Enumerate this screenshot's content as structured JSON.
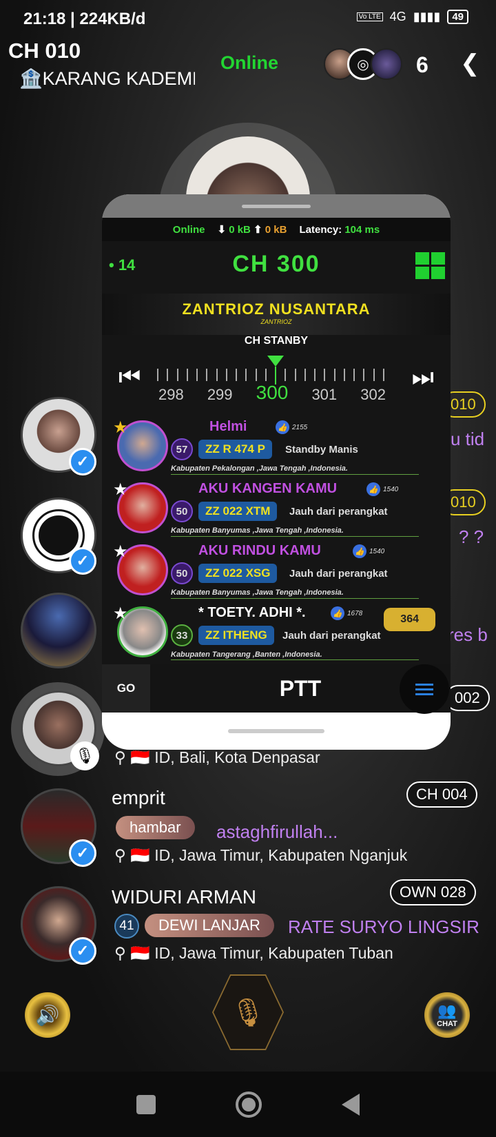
{
  "status_bar": {
    "time": "21:18 | 224KB/d",
    "network": "4G",
    "battery": "49",
    "volte": "Vo LTE"
  },
  "header": {
    "channel": "CH 010",
    "room_name": "🏦KARANG KADEMPER",
    "status": "Online",
    "viewer_count": "6",
    "back_icon": "chevron-left-icon"
  },
  "ptt": {
    "net": {
      "online": "Online",
      "down": "0 kB",
      "up": "0 kB",
      "latency_label": "Latency:",
      "latency": "104 ms"
    },
    "users_online": "• 14",
    "channel": "CH 300",
    "banner_title": "ZANTRIOZ NUSANTARA",
    "banner_sub": "ZANTRIOZ",
    "stanby": "CH STANBY",
    "freqs": [
      "298",
      "299",
      "300",
      "301",
      "302"
    ],
    "users": [
      {
        "name": "Helmi",
        "likes": "2155",
        "level": "57",
        "call": "ZZ R 474 P",
        "status": "Standby Manis",
        "location": "Kabupaten Pekalongan ,Jawa Tengah ,Indonesia."
      },
      {
        "name": "AKU KANGEN KAMU",
        "likes": "1540",
        "level": "50",
        "call": "ZZ 022 XTM",
        "status": "Jauh dari perangkat",
        "location": "Kabupaten Banyumas ,Jawa Tengah ,Indonesia."
      },
      {
        "name": "AKU RINDU KAMU",
        "likes": "1540",
        "level": "50",
        "call": "ZZ 022 XSG",
        "status": "Jauh dari perangkat",
        "location": "Kabupaten Banyumas ,Jawa Tengah ,Indonesia."
      },
      {
        "name": "* TOETY. ADHI *.",
        "likes": "1678",
        "level": "33",
        "call": "ZZ ITHENG",
        "status": "Jauh dari perangkat",
        "location": "Kabupaten Tangerang ,Banten ,Indonesia."
      }
    ],
    "count_badge": "364",
    "go_label": "GO",
    "ptt_label": "PTT"
  },
  "chat": {
    "right_fragments": [
      "010",
      "u tid",
      "010",
      "? ?",
      "res b",
      "002"
    ],
    "row0_loc": "ID, Bali, Kota Denpasar",
    "rows": [
      {
        "name": "emprit",
        "channel": "CH 004",
        "tag": "hambar",
        "message": "astaghfirullah...",
        "location": "ID, Jawa Timur, Kabupaten Nganjuk"
      },
      {
        "name": "WIDURI ARMAN",
        "channel": "OWN 028",
        "level": "41",
        "tag": "DEWI LANJAR",
        "message": "RATE SURYO LINGSIR",
        "location": "ID, Jawa Timur, Kabupaten Tuban"
      }
    ]
  },
  "controls": {
    "chat_label": "CHAT"
  },
  "colors": {
    "accent_green": "#40e040",
    "name_purple": "#c050e0",
    "badge_gold": "#d8b030"
  }
}
